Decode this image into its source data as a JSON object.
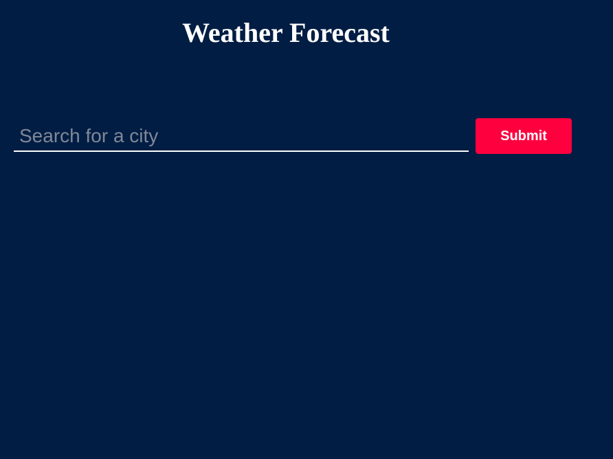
{
  "header": {
    "title": "Weather Forecast"
  },
  "search": {
    "placeholder": "Search for a city",
    "value": "",
    "submit_label": "Submit"
  },
  "colors": {
    "background": "#021d44",
    "accent": "#ff003f",
    "text": "#ffffff",
    "placeholder": "#7f8897"
  }
}
